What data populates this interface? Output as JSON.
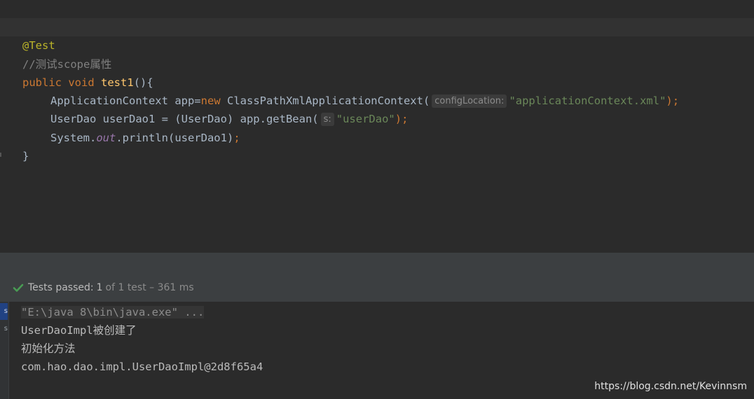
{
  "editor": {
    "lines": {
      "l1": {
        "annotation": "@Test"
      },
      "l2": {
        "comment": "//测试scope属性"
      },
      "l3": {
        "kw_public": "public",
        "kw_void": "void",
        "method": "test1",
        "rest": "(){"
      },
      "l4": {
        "type": "ApplicationContext",
        "var": " app=",
        "kw_new": "new",
        "ctor": " ClassPathXmlApplicationContext(",
        "hint": "configLocation:",
        "str": "\"applicationContext.xml\"",
        "end": ");"
      },
      "l5": {
        "code": "UserDao userDao1 = (UserDao) app.getBean(",
        "hint": "s:",
        "str": "\"userDao\"",
        "end": ");"
      },
      "l6": {
        "pre": "System.",
        "field": "out",
        "post": ".println(userDao1)",
        "semi": ";"
      },
      "l7": {
        "brace": "}"
      }
    }
  },
  "test_status": {
    "label": "Tests passed:",
    "count": "1",
    "detail": "of 1 test – 361 ms",
    "icon": "check-icon",
    "color": "#499c54"
  },
  "console": {
    "tabs": [
      "s",
      "s"
    ],
    "lines": [
      "\"E:\\java 8\\bin\\java.exe\" ...",
      "UserDaoImpl被创建了",
      "初始化方法",
      "com.hao.dao.impl.UserDaoImpl@2d8f65a4"
    ]
  },
  "watermark": "https://blog.csdn.net/Kevinnsm"
}
